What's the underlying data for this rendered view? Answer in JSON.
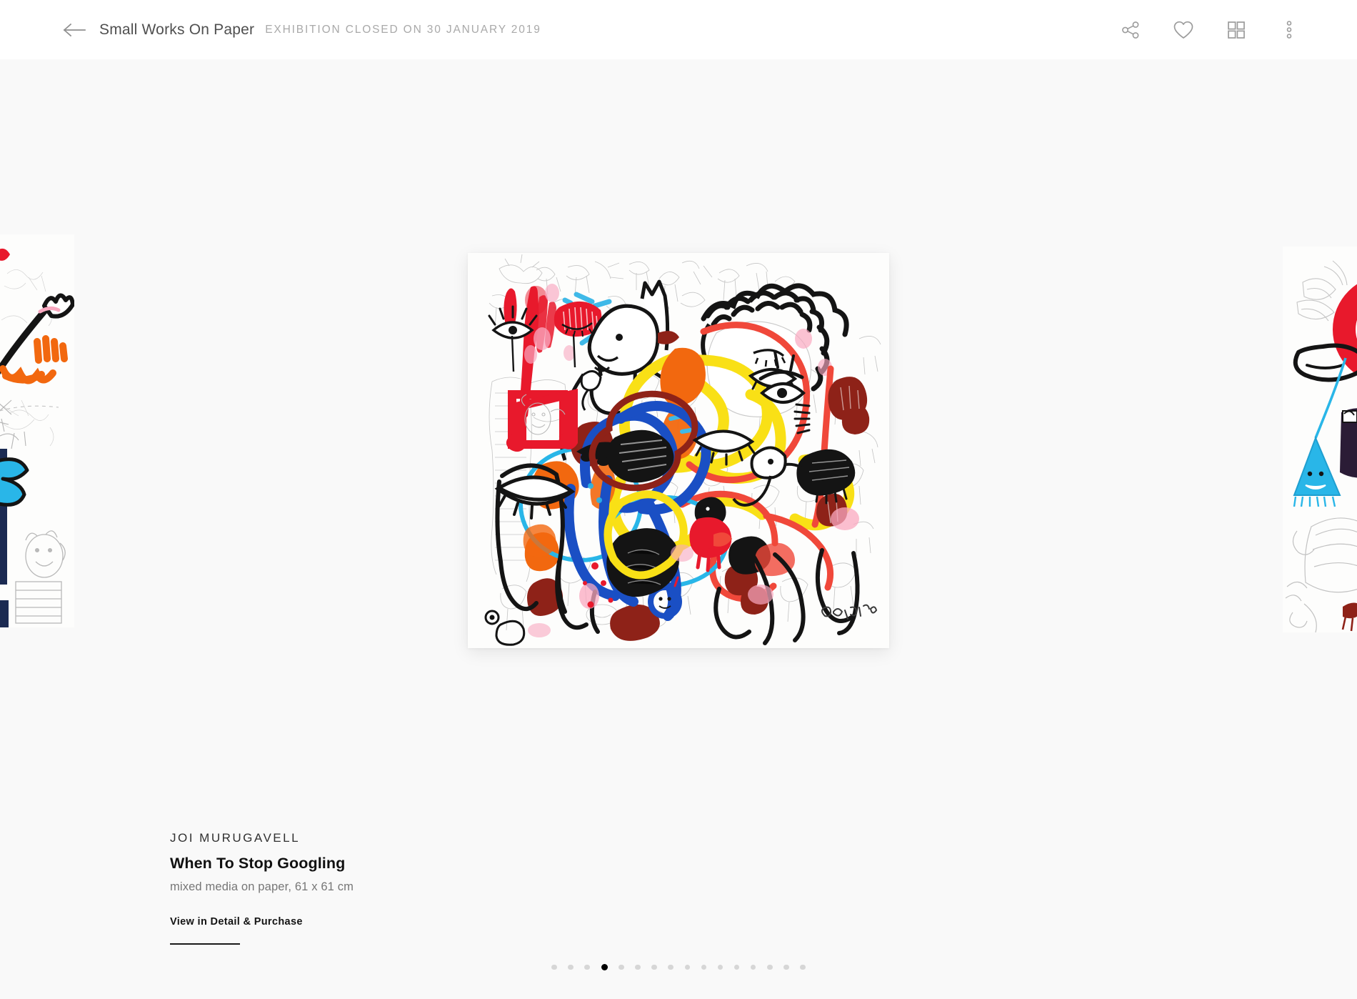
{
  "header": {
    "back_icon": "back-arrow-icon",
    "exhibition_title": "Small Works On Paper",
    "exhibition_status": "EXHIBITION CLOSED ON 30 JANUARY 2019",
    "actions": [
      {
        "name": "share-icon",
        "label": "Share"
      },
      {
        "name": "heart-icon",
        "label": "Favorite"
      },
      {
        "name": "grid-view-icon",
        "label": "Grid View"
      },
      {
        "name": "more-menu-icon",
        "label": "More Options"
      }
    ]
  },
  "artwork": {
    "artist": "JOI MURUGAVELL",
    "title": "When To Stop Googling",
    "medium": "mixed media on paper, 61 x 61 cm",
    "detail_link": "View in Detail & Purchase",
    "signature": "doodlies"
  },
  "pagination": {
    "total": 16,
    "active_index": 3
  },
  "colors": {
    "page_background": "#f9f9f9",
    "header_background": "#ffffff",
    "title_text": "#4f4f4f",
    "status_text": "#a9a9a9",
    "icon_stroke": "#9b9b9b",
    "caption_artist": "#303030",
    "caption_title": "#111111",
    "caption_medium": "#767676",
    "dot_inactive": "#d6d6d6",
    "dot_active": "#000000",
    "art_red": "#e8192c",
    "art_yellow": "#f9e016",
    "art_blue": "#1a4fc4",
    "art_cyan": "#29b6e8",
    "art_orange": "#f2680f",
    "art_pink": "#f9a8c0",
    "art_darkred": "#8e2218",
    "art_black": "#111111"
  }
}
